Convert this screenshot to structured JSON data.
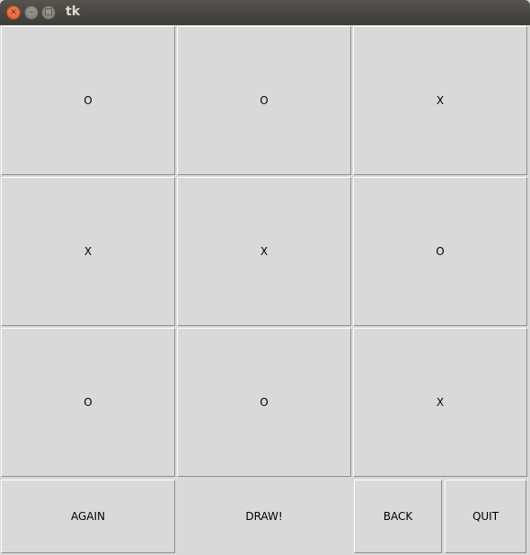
{
  "window": {
    "title": "tk",
    "controls": {
      "close_glyph": "×",
      "minimize_glyph": "–",
      "maximize_glyph": "□"
    }
  },
  "board": {
    "cells": [
      "O",
      "O",
      "X",
      "X",
      "X",
      "O",
      "O",
      "O",
      "X"
    ]
  },
  "controls": {
    "again_label": "AGAIN",
    "status_text": "DRAW!",
    "back_label": "BACK",
    "quit_label": "QUIT"
  },
  "colors": {
    "background": "#d9d9d9",
    "titlebar": "#3c3b37",
    "close_button": "#e0542a"
  }
}
